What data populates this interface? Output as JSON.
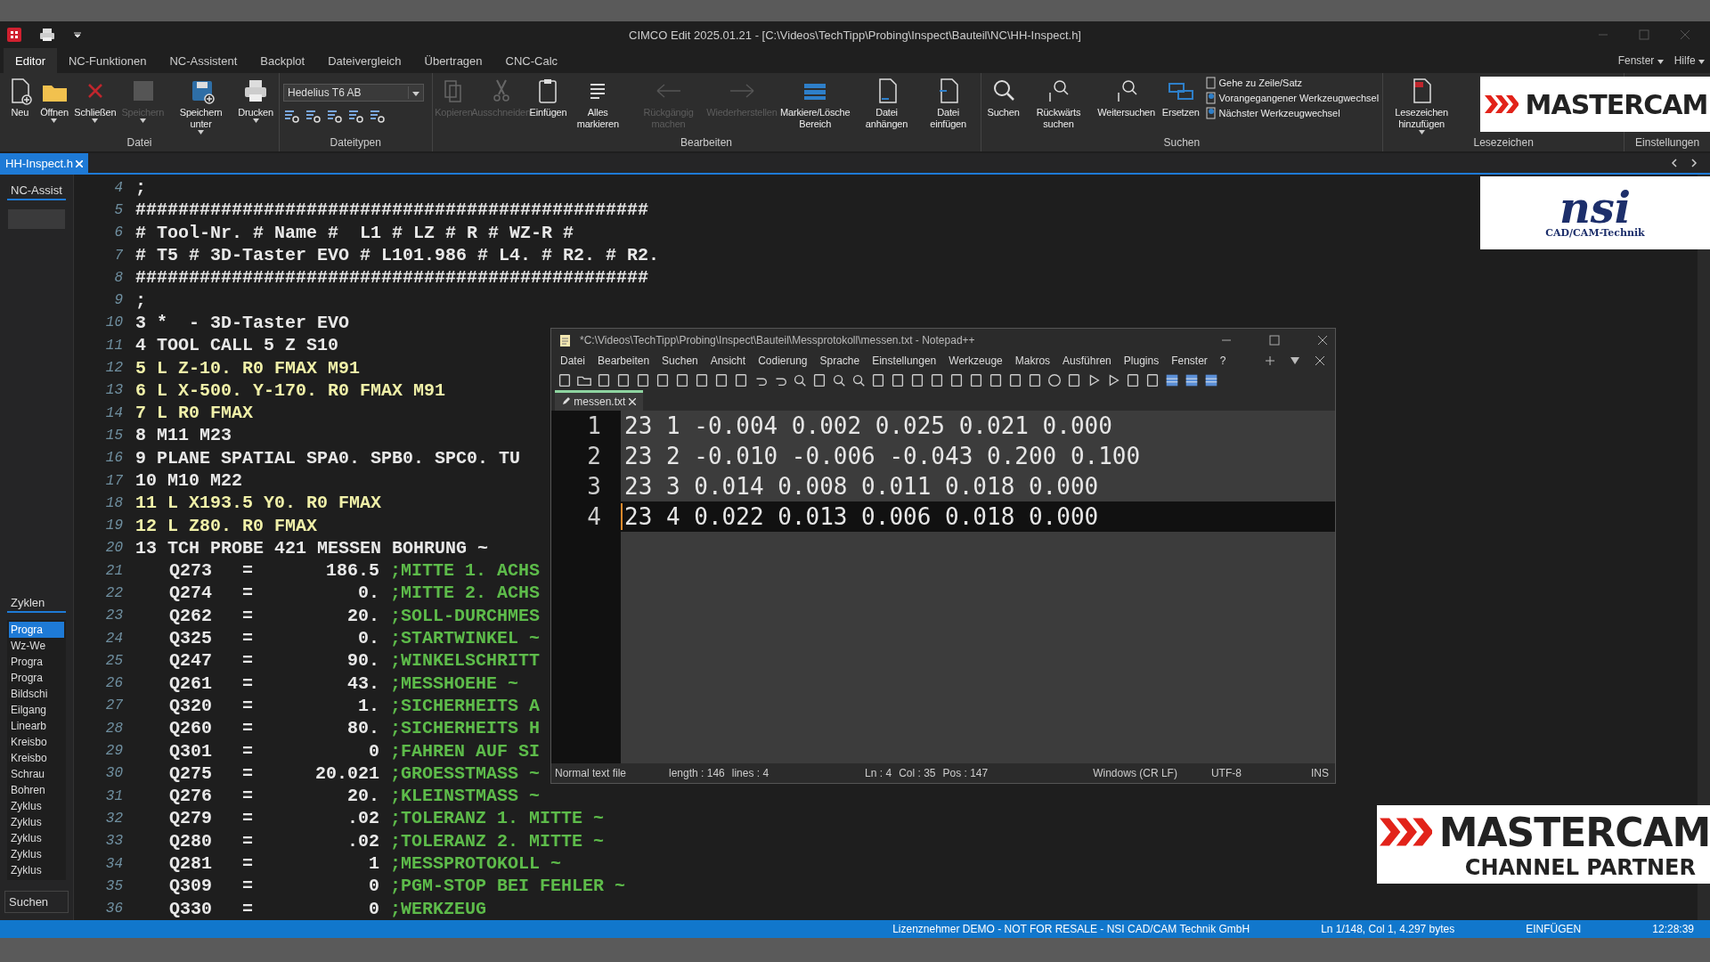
{
  "window": {
    "title": "CIMCO Edit 2025.01.21 - [C:\\Videos\\TechTipp\\Probing\\Inspect\\Bauteil\\NC\\HH-Inspect.h]"
  },
  "ribbon_tabs": [
    {
      "label": "Editor",
      "selected": true
    },
    {
      "label": "NC-Funktionen",
      "selected": false
    },
    {
      "label": "NC-Assistent",
      "selected": false
    },
    {
      "label": "Backplot",
      "selected": false
    },
    {
      "label": "Dateivergleich",
      "selected": false
    },
    {
      "label": "Übertragen",
      "selected": false
    },
    {
      "label": "CNC-Calc",
      "selected": false
    }
  ],
  "menu_right": [
    "Fenster",
    "Hilfe"
  ],
  "ribbon_groups": [
    {
      "label": "Datei",
      "kind": "buttons",
      "buttons": [
        {
          "label": "Neu",
          "disabled": false,
          "menu": false
        },
        {
          "label": "Öffnen",
          "disabled": false,
          "menu": true
        },
        {
          "label": "Schließen",
          "disabled": false,
          "menu": true
        },
        {
          "label": "Speichern",
          "disabled": true,
          "menu": true
        },
        {
          "label": "Speichern unter",
          "disabled": false,
          "menu": true
        },
        {
          "label": "Drucken",
          "disabled": false,
          "menu": true
        }
      ]
    },
    {
      "label": "Dateitypen",
      "kind": "dropdown",
      "value": "Hedelius T6 AB"
    },
    {
      "label": "Bearbeiten",
      "kind": "buttons",
      "buttons": [
        {
          "label": "Kopieren",
          "disabled": true,
          "menu": false
        },
        {
          "label": "Ausschneiden",
          "disabled": true,
          "menu": false
        },
        {
          "label": "Einfügen",
          "disabled": false,
          "menu": false
        },
        {
          "label": "Alles markieren",
          "disabled": false,
          "menu": false
        },
        {
          "label": "Rückgängig machen",
          "disabled": true,
          "menu": false
        },
        {
          "label": "Wiederherstellen",
          "disabled": true,
          "menu": false
        },
        {
          "label": "Markiere/Lösche Bereich",
          "disabled": false,
          "menu": false
        },
        {
          "label": "Datei anhängen",
          "disabled": false,
          "menu": false
        },
        {
          "label": "Datei einfügen",
          "disabled": false,
          "menu": false
        }
      ]
    },
    {
      "label": "Suchen",
      "kind": "search",
      "buttons": [
        {
          "label": "Suchen",
          "disabled": false,
          "menu": false
        },
        {
          "label": "Rückwärts suchen",
          "disabled": false,
          "menu": false
        },
        {
          "label": "Weitersuchen",
          "disabled": false,
          "menu": false
        },
        {
          "label": "Ersetzen",
          "disabled": false,
          "menu": false
        }
      ],
      "links": [
        "Gehe zu Zeile/Satz",
        "Vorangegangener Werkzeugwechsel",
        "Nächster Werkzeugwechsel"
      ]
    },
    {
      "label": "Lesezeichen",
      "kind": "buttons",
      "buttons": [
        {
          "label": "Lesezeichen hinzufügen",
          "disabled": false,
          "menu": true
        }
      ]
    },
    {
      "label": "Einstellungen",
      "kind": "empty"
    }
  ],
  "document_tabs": [
    {
      "label": "HH-Inspect.h",
      "selected": true
    }
  ],
  "left_panel": {
    "top_tab": "NC-Assist",
    "bottom_tab": "Zyklen",
    "cycles": [
      {
        "label": "Progra",
        "selected": true
      },
      {
        "label": "Wz-We",
        "selected": false
      },
      {
        "label": "Progra",
        "selected": false
      },
      {
        "label": "Progra",
        "selected": false
      },
      {
        "label": "Bildschi",
        "selected": false
      },
      {
        "label": "Eilgang",
        "selected": false
      },
      {
        "label": "Linearb",
        "selected": false
      },
      {
        "label": "Kreisbo",
        "selected": false
      },
      {
        "label": "Kreisbo",
        "selected": false
      },
      {
        "label": "Schrau",
        "selected": false
      },
      {
        "label": "Bohren",
        "selected": false
      },
      {
        "label": "Zyklus",
        "selected": false
      },
      {
        "label": "Zyklus",
        "selected": false
      },
      {
        "label": "Zyklus",
        "selected": false
      },
      {
        "label": "Zyklus",
        "selected": false
      },
      {
        "label": "Zyklus",
        "selected": false
      }
    ],
    "search_button": "Suchen"
  },
  "code_lines": [
    {
      "num": "4",
      "kind": "plain",
      "text": ";"
    },
    {
      "num": "5",
      "kind": "plain",
      "text": "################################################"
    },
    {
      "num": "6",
      "kind": "plain",
      "text": "# Tool-Nr. # Name #  L1 # LZ # R # WZ-R #"
    },
    {
      "num": "7",
      "kind": "plain",
      "text": "# T5 # 3D-Taster EVO # L101.986 # L4. # R2. # R2."
    },
    {
      "num": "8",
      "kind": "plain",
      "text": "################################################"
    },
    {
      "num": "9",
      "kind": "plain",
      "text": ";"
    },
    {
      "num": "10",
      "kind": "plain",
      "text": "3 *  - 3D-Taster EVO"
    },
    {
      "num": "11",
      "kind": "plain",
      "text": "4 TOOL CALL 5 Z S10"
    },
    {
      "num": "12",
      "kind": "move",
      "text": "5 L Z-10. R0 FMAX M91"
    },
    {
      "num": "13",
      "kind": "move",
      "text": "6 L X-500. Y-170. R0 FMAX M91"
    },
    {
      "num": "14",
      "kind": "move",
      "text": "7 L R0 FMAX"
    },
    {
      "num": "15",
      "kind": "plain",
      "text": "8 M11 M23"
    },
    {
      "num": "16",
      "kind": "plain",
      "text": "9 PLANE SPATIAL SPA0. SPB0. SPC0. TU"
    },
    {
      "num": "17",
      "kind": "plain",
      "text": "10 M10 M22"
    },
    {
      "num": "18",
      "kind": "move",
      "text": "11 L X193.5 Y0. R0 FMAX"
    },
    {
      "num": "19",
      "kind": "move",
      "text": "12 L Z80. R0 FMAX"
    },
    {
      "num": "20",
      "kind": "plain",
      "text": "13 TCH PROBE 421 MESSEN BOHRUNG ~"
    },
    {
      "num": "21",
      "kind": "param",
      "param": "Q273",
      "sign": "=",
      "value": "186.5",
      "comment": ";MITTE 1. ACHS"
    },
    {
      "num": "22",
      "kind": "param",
      "param": "Q274",
      "sign": "=",
      "value": "0.",
      "comment": ";MITTE 2. ACHS"
    },
    {
      "num": "23",
      "kind": "param",
      "param": "Q262",
      "sign": "=",
      "value": "20.",
      "comment": ";SOLL-DURCHMES"
    },
    {
      "num": "24",
      "kind": "param",
      "param": "Q325",
      "sign": "=",
      "value": "0.",
      "comment": ";STARTWINKEL ~"
    },
    {
      "num": "25",
      "kind": "param",
      "param": "Q247",
      "sign": "=",
      "value": "90.",
      "comment": ";WINKELSCHRITT"
    },
    {
      "num": "26",
      "kind": "param",
      "param": "Q261",
      "sign": "=",
      "value": "43.",
      "comment": ";MESSHOEHE ~"
    },
    {
      "num": "27",
      "kind": "param",
      "param": "Q320",
      "sign": "=",
      "value": "1.",
      "comment": ";SICHERHEITS A"
    },
    {
      "num": "28",
      "kind": "param",
      "param": "Q260",
      "sign": "=",
      "value": "80.",
      "comment": ";SICHERHEITS H"
    },
    {
      "num": "29",
      "kind": "param",
      "param": "Q301",
      "sign": "=",
      "value": "0",
      "comment": ";FAHREN AUF SI"
    },
    {
      "num": "30",
      "kind": "param",
      "param": "Q275",
      "sign": "=",
      "value": "20.021",
      "comment": ";GROESSTMASS ~"
    },
    {
      "num": "31",
      "kind": "param",
      "param": "Q276",
      "sign": "=",
      "value": "20.",
      "comment": ";KLEINSTMASS ~"
    },
    {
      "num": "32",
      "kind": "param",
      "param": "Q279",
      "sign": "=",
      "value": ".02",
      "comment": ";TOLERANZ 1. MITTE ~"
    },
    {
      "num": "33",
      "kind": "param",
      "param": "Q280",
      "sign": "=",
      "value": ".02",
      "comment": ";TOLERANZ 2. MITTE ~"
    },
    {
      "num": "34",
      "kind": "param",
      "param": "Q281",
      "sign": "=",
      "value": "1",
      "comment": ";MESSPROTOKOLL ~"
    },
    {
      "num": "35",
      "kind": "param",
      "param": "Q309",
      "sign": "=",
      "value": "0",
      "comment": ";PGM-STOP BEI FEHLER ~"
    },
    {
      "num": "36",
      "kind": "param",
      "param": "Q330",
      "sign": "=",
      "value": "0",
      "comment": ";WERKZEUG"
    }
  ],
  "status_bar": {
    "license": "Lizenznehmer DEMO - NOT FOR RESALE - NSI CAD/CAM Technik GmbH",
    "position": "Ln 1/148, Col 1, 4.297 bytes",
    "mode": "EINFÜGEN",
    "time": "12:28:39"
  },
  "notepad": {
    "title": "*C:\\Videos\\TechTipp\\Probing\\Inspect\\Bauteil\\Messprotokoll\\messen.txt - Notepad++",
    "menu": [
      "Datei",
      "Bearbeiten",
      "Suchen",
      "Ansicht",
      "Codierung",
      "Sprache",
      "Einstellungen",
      "Werkzeuge",
      "Makros",
      "Ausführen",
      "Plugins",
      "Fenster",
      "?"
    ],
    "tabs": [
      {
        "label": "messen.txt",
        "selected": true
      }
    ],
    "lines": [
      {
        "num": "1",
        "text": "23 1 -0.004 0.002 0.025 0.021 0.000",
        "selected": false
      },
      {
        "num": "2",
        "text": "23 2 -0.010 -0.006 -0.043 0.200 0.100",
        "selected": false
      },
      {
        "num": "3",
        "text": "23 3 0.014 0.008 0.011 0.018 0.000",
        "selected": false
      },
      {
        "num": "4",
        "text": "23 4 0.022 0.013 0.006 0.018 0.000",
        "selected": true
      }
    ],
    "status": [
      "Normal text file",
      "length : 146",
      "lines : 4",
      "Ln : 4",
      "Col : 35",
      "Pos : 147",
      "Windows (CR LF)",
      "UTF-8",
      "INS"
    ]
  },
  "overlays": [
    {
      "kind": "mastercam",
      "text": "MASTERCAM"
    },
    {
      "kind": "nsi",
      "text": "nsi",
      "sub": "CAD/CAM-Technik"
    },
    {
      "kind": "partner",
      "text": "MASTERCAM",
      "sub": "CHANNEL PARTNER"
    }
  ]
}
